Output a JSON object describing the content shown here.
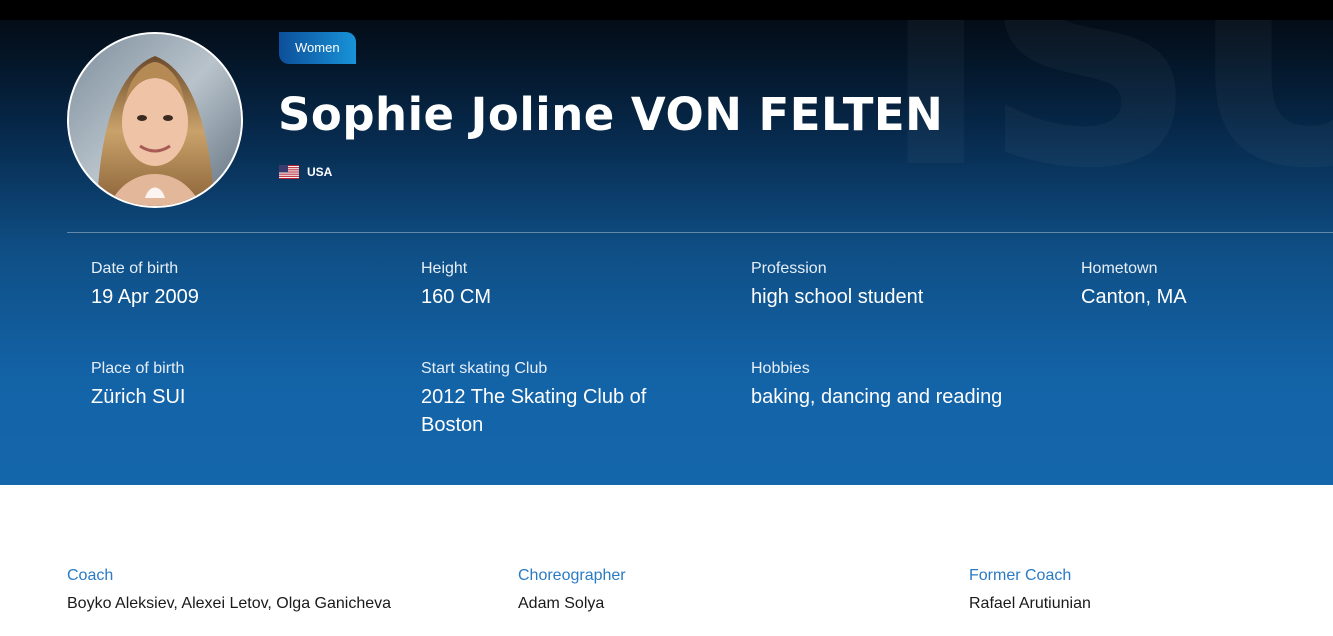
{
  "profile": {
    "category": "Women",
    "name": "Sophie Joline VON FELTEN",
    "nation": "USA"
  },
  "facts": {
    "dob_label": "Date of birth",
    "dob": "19 Apr 2009",
    "height_label": "Height",
    "height": "160 CM",
    "profession_label": "Profession",
    "profession": "high school student",
    "hometown_label": "Hometown",
    "hometown": "Canton, MA",
    "birthplace_label": "Place of birth",
    "birthplace": "Zürich SUI",
    "club_label": "Start skating Club",
    "club_line1": "2012 The Skating Club of",
    "club_line2": "Boston",
    "hobbies_label": "Hobbies",
    "hobbies": "baking, dancing and reading"
  },
  "team": {
    "coach_label": "Coach",
    "coach": "Boyko Aleksiev, Alexei Letov, Olga Ganicheva",
    "choreographer_label": "Choreographer",
    "choreographer": "Adam Solya",
    "former_coach_label": "Former Coach",
    "former_coach": "Rafael Arutiunian"
  },
  "icons": {
    "avatar": "athlete-photo",
    "flag": "usa-flag-icon"
  },
  "colors": {
    "hero_top": "#03080f",
    "hero_bottom": "#1466ab",
    "accent_blue": "#2a7bc4",
    "badge_start": "#0d4f9a",
    "badge_end": "#1893d8"
  }
}
